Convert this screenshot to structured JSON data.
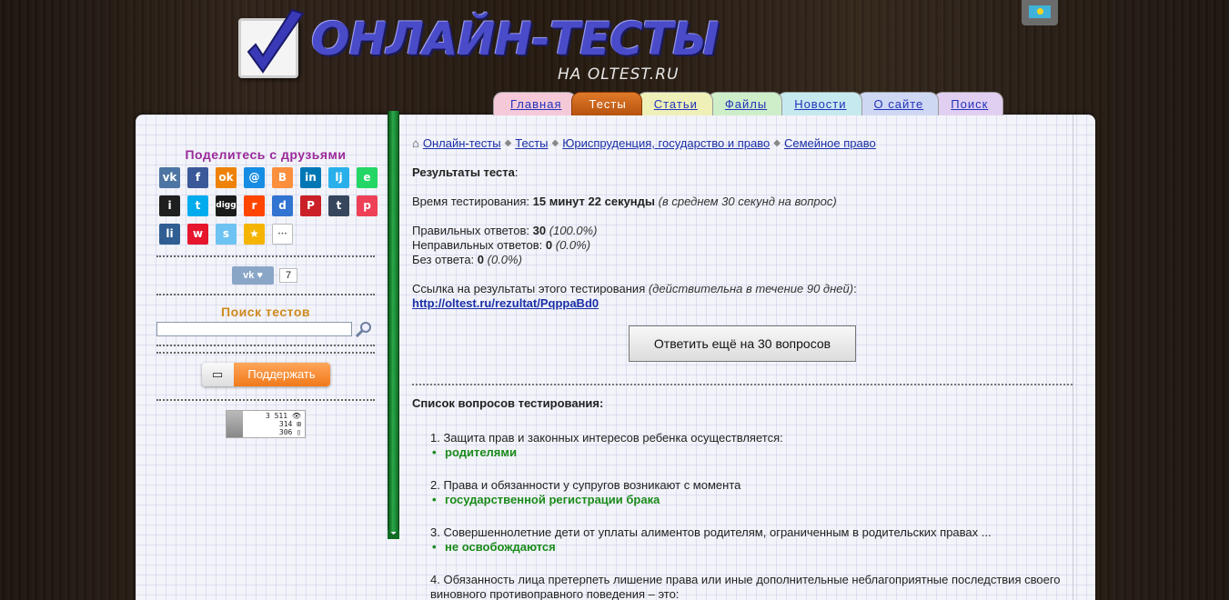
{
  "header": {
    "logo_title": "ОНЛАЙН-ТЕСТЫ",
    "logo_subtitle": "НА OLTEST.RU"
  },
  "nav": {
    "tabs": [
      {
        "label": "Главная",
        "color": "#f5c9d8"
      },
      {
        "label": "Тесты",
        "color": "#c8621a",
        "active": true
      },
      {
        "label": "Статьи",
        "color": "#eef0b8"
      },
      {
        "label": "Файлы",
        "color": "#cdeec9"
      },
      {
        "label": "Новости",
        "color": "#c6e9ef"
      },
      {
        "label": "О сайте",
        "color": "#cfd8f3"
      },
      {
        "label": "Поиск",
        "color": "#e1cff1"
      }
    ]
  },
  "sidebar": {
    "share_title": "Поделитесь с друзьями",
    "social": [
      {
        "name": "vk",
        "glyph": "vk",
        "color": "#4c75a3"
      },
      {
        "name": "facebook",
        "glyph": "f",
        "color": "#3b5998"
      },
      {
        "name": "odnoklassniki",
        "glyph": "ok",
        "color": "#ee8208"
      },
      {
        "name": "moimir",
        "glyph": "@",
        "color": "#168de2"
      },
      {
        "name": "blogger",
        "glyph": "B",
        "color": "#fb8f3d"
      },
      {
        "name": "linkedin",
        "glyph": "in",
        "color": "#0077b5"
      },
      {
        "name": "livejournal",
        "glyph": "lj",
        "color": "#29b0ea"
      },
      {
        "name": "evernote",
        "glyph": "e",
        "color": "#24d666"
      },
      {
        "name": "instapaper",
        "glyph": "i",
        "color": "#1f1f1f"
      },
      {
        "name": "twitter",
        "glyph": "t",
        "color": "#00aced"
      },
      {
        "name": "digg",
        "glyph": "digg",
        "color": "#1b1b1b"
      },
      {
        "name": "reddit",
        "glyph": "r",
        "color": "#ff4500"
      },
      {
        "name": "delicious",
        "glyph": "d",
        "color": "#3274d1"
      },
      {
        "name": "pinterest",
        "glyph": "P",
        "color": "#cb2027"
      },
      {
        "name": "tumblr",
        "glyph": "t",
        "color": "#36465d"
      },
      {
        "name": "pocket",
        "glyph": "p",
        "color": "#ee4056"
      },
      {
        "name": "liveinternet",
        "glyph": "li",
        "color": "#2f5e93"
      },
      {
        "name": "weibo",
        "glyph": "w",
        "color": "#e6162d"
      },
      {
        "name": "surfingbird",
        "glyph": "s",
        "color": "#6dc3f2"
      },
      {
        "name": "bookmarks",
        "glyph": "★",
        "color": "#f4b400"
      },
      {
        "name": "more",
        "glyph": "···",
        "color": "#ffffff"
      }
    ],
    "vk_like_label": "vk ♥",
    "vk_like_count": "7",
    "search_title": "Поиск тестов",
    "search_placeholder": "",
    "donate_label": "Поддержать",
    "counter": [
      "3 511 👁",
      "314 ⊞",
      "306 ▯"
    ]
  },
  "content": {
    "breadcrumb": [
      "Онлайн-тесты",
      "Тесты",
      "Юриспруденция, государство и право",
      "Семейное право"
    ],
    "results_title": "Результаты теста",
    "time_label": "Время тестирования: ",
    "time_value": "15 минут 22 секунды",
    "time_note": "(в среднем 30 секунд на вопрос)",
    "correct_label": "Правильных ответов: ",
    "correct_value": "30",
    "correct_pct": "(100.0%)",
    "wrong_label": "Неправильных ответов: ",
    "wrong_value": "0",
    "wrong_pct": "(0.0%)",
    "noanswer_label": "Без ответа: ",
    "noanswer_value": "0",
    "noanswer_pct": "(0.0%)",
    "link_label": "Ссылка на результаты этого тестирования ",
    "link_note": "(действительна в течение 90 дней)",
    "link_url": "http://oltest.ru/rezultat/PqppaBd0",
    "retry_button": "Ответить ещё на 30 вопросов",
    "questions_title": "Список вопросов тестирования:",
    "questions": [
      {
        "q": "1. Защита прав и законных интересов ребенка осуществляется:",
        "a": "родителями"
      },
      {
        "q": "2. Права и обязанности у супругов возникают с момента",
        "a": "государственной регистрации брака"
      },
      {
        "q": "3. Совершеннолетние дети от уплаты алиментов родителям, ограниченным в родительских правах ...",
        "a": "не освобождаются"
      },
      {
        "q": "4. Обязанность лица претерпеть лишение права или иные дополнительные неблагоприятные последствия своего виновного противоправного поведения – это:",
        "a": ""
      }
    ]
  }
}
